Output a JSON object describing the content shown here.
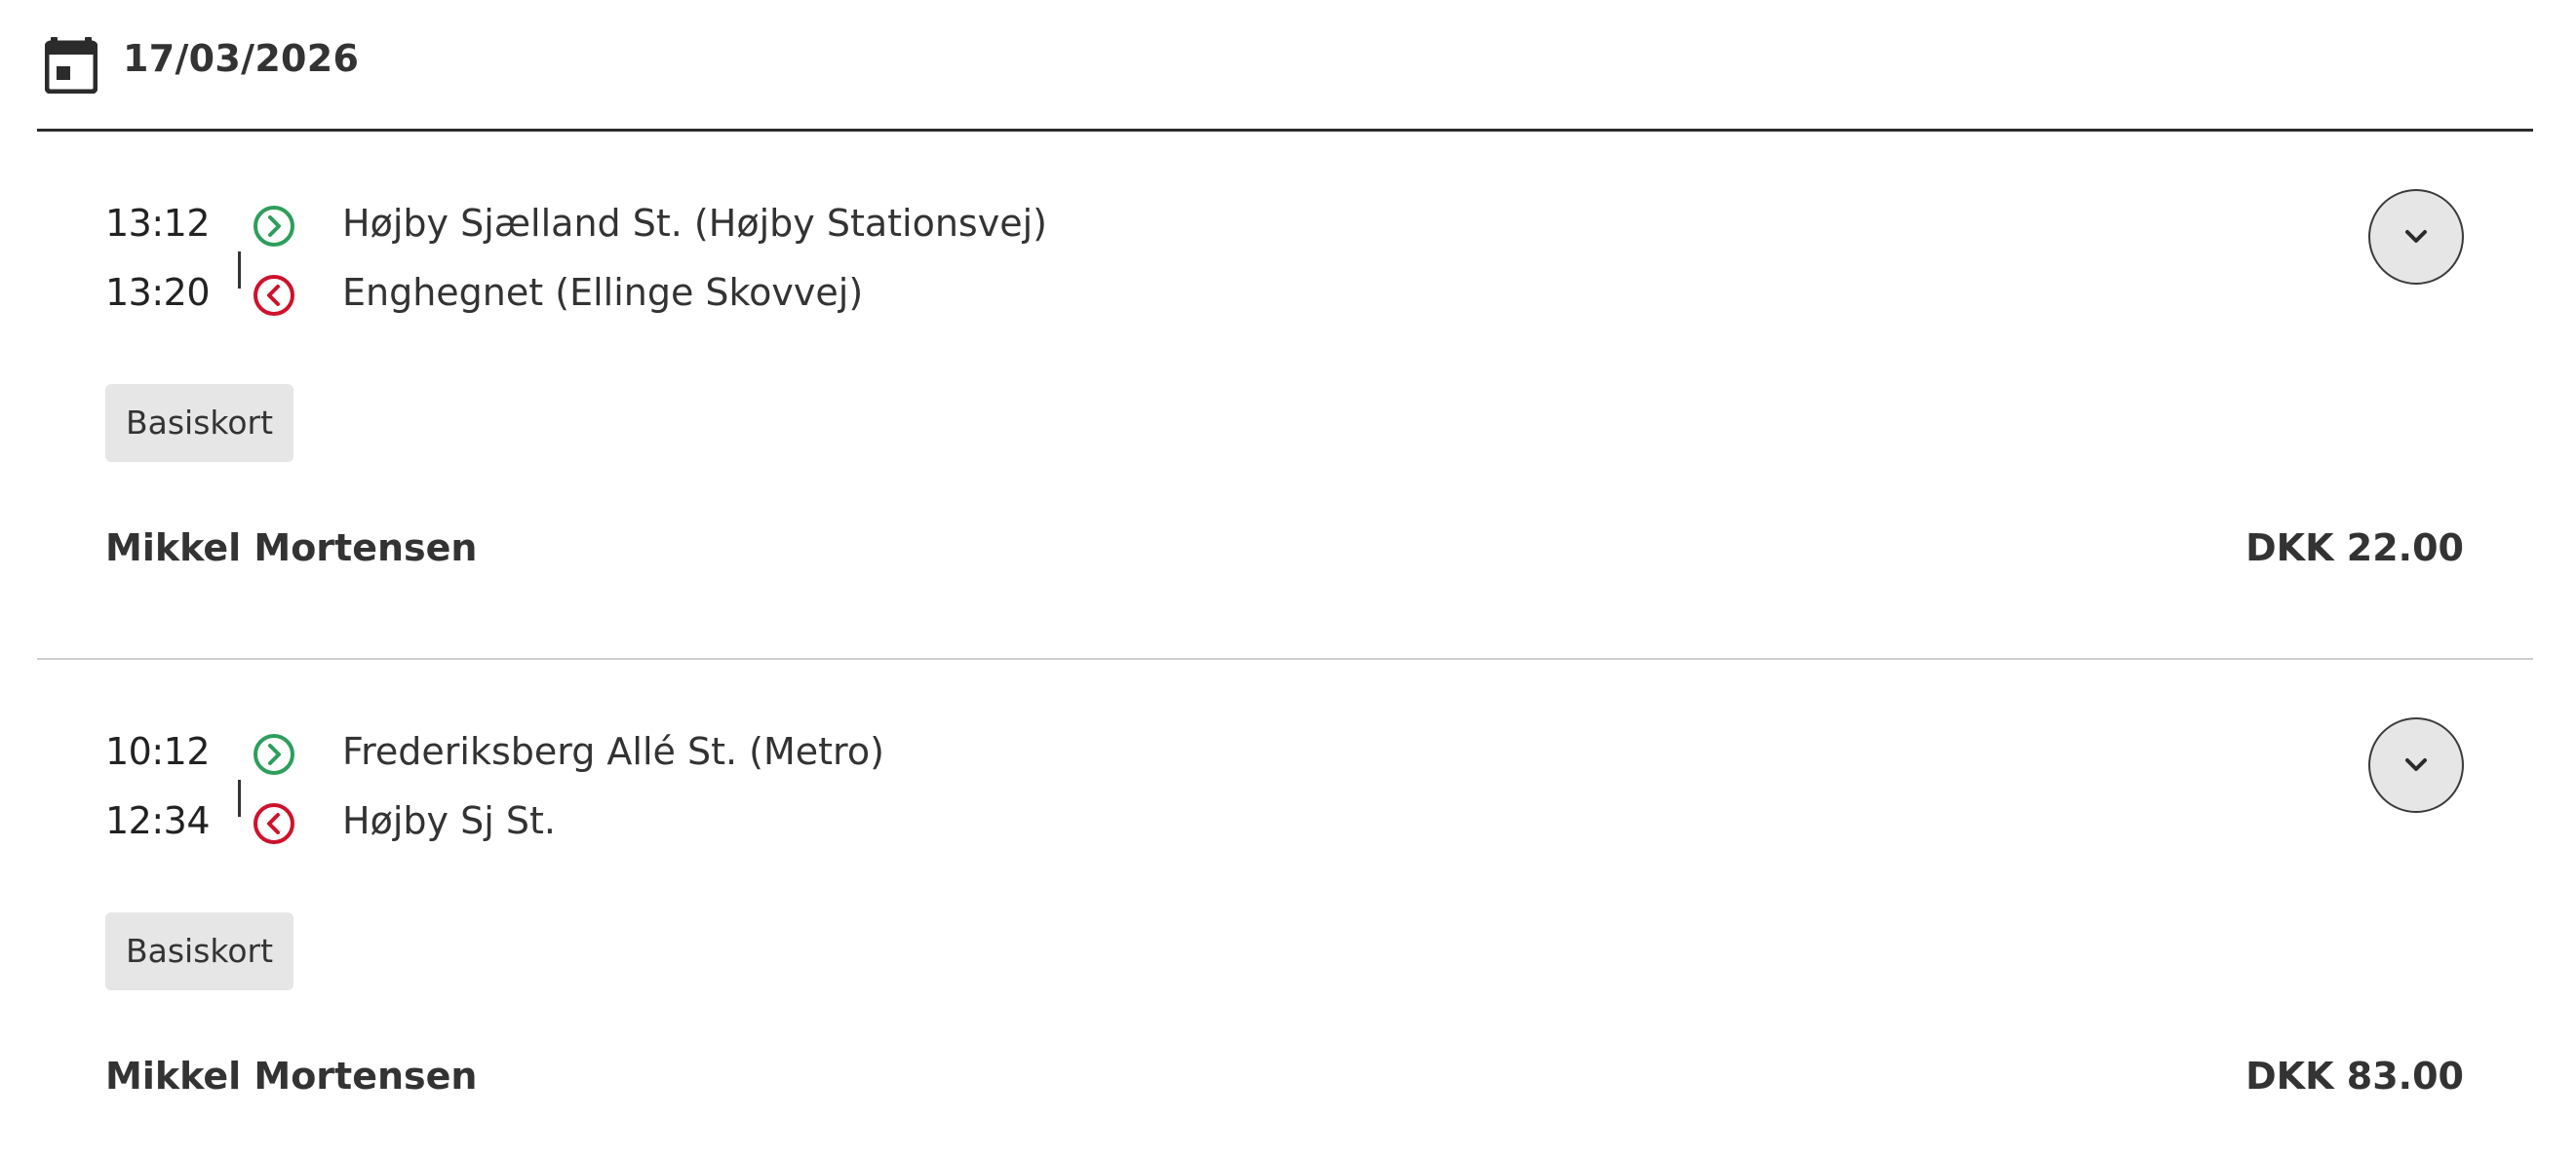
{
  "header": {
    "date": "17/03/2026",
    "icon": "calendar-icon"
  },
  "colors": {
    "departure": "#2e9e5b",
    "arrival": "#d0112b",
    "text": "#333333",
    "badge_bg": "#e6e6e6"
  },
  "trips": [
    {
      "departure_time": "13:12",
      "departure_stop": "Højby Sjælland St. (Højby Stationsvej)",
      "arrival_time": "13:20",
      "arrival_stop": "Enghegnet (Ellinge Skovvej)",
      "ticket_type": "Basiskort",
      "passenger": "Mikkel Mortensen",
      "price": "DKK 22.00"
    },
    {
      "departure_time": "10:12",
      "departure_stop": "Frederiksberg Allé St. (Metro)",
      "arrival_time": "12:34",
      "arrival_stop": "Højby Sj St.",
      "ticket_type": "Basiskort",
      "passenger": "Mikkel Mortensen",
      "price": "DKK 83.00"
    }
  ]
}
